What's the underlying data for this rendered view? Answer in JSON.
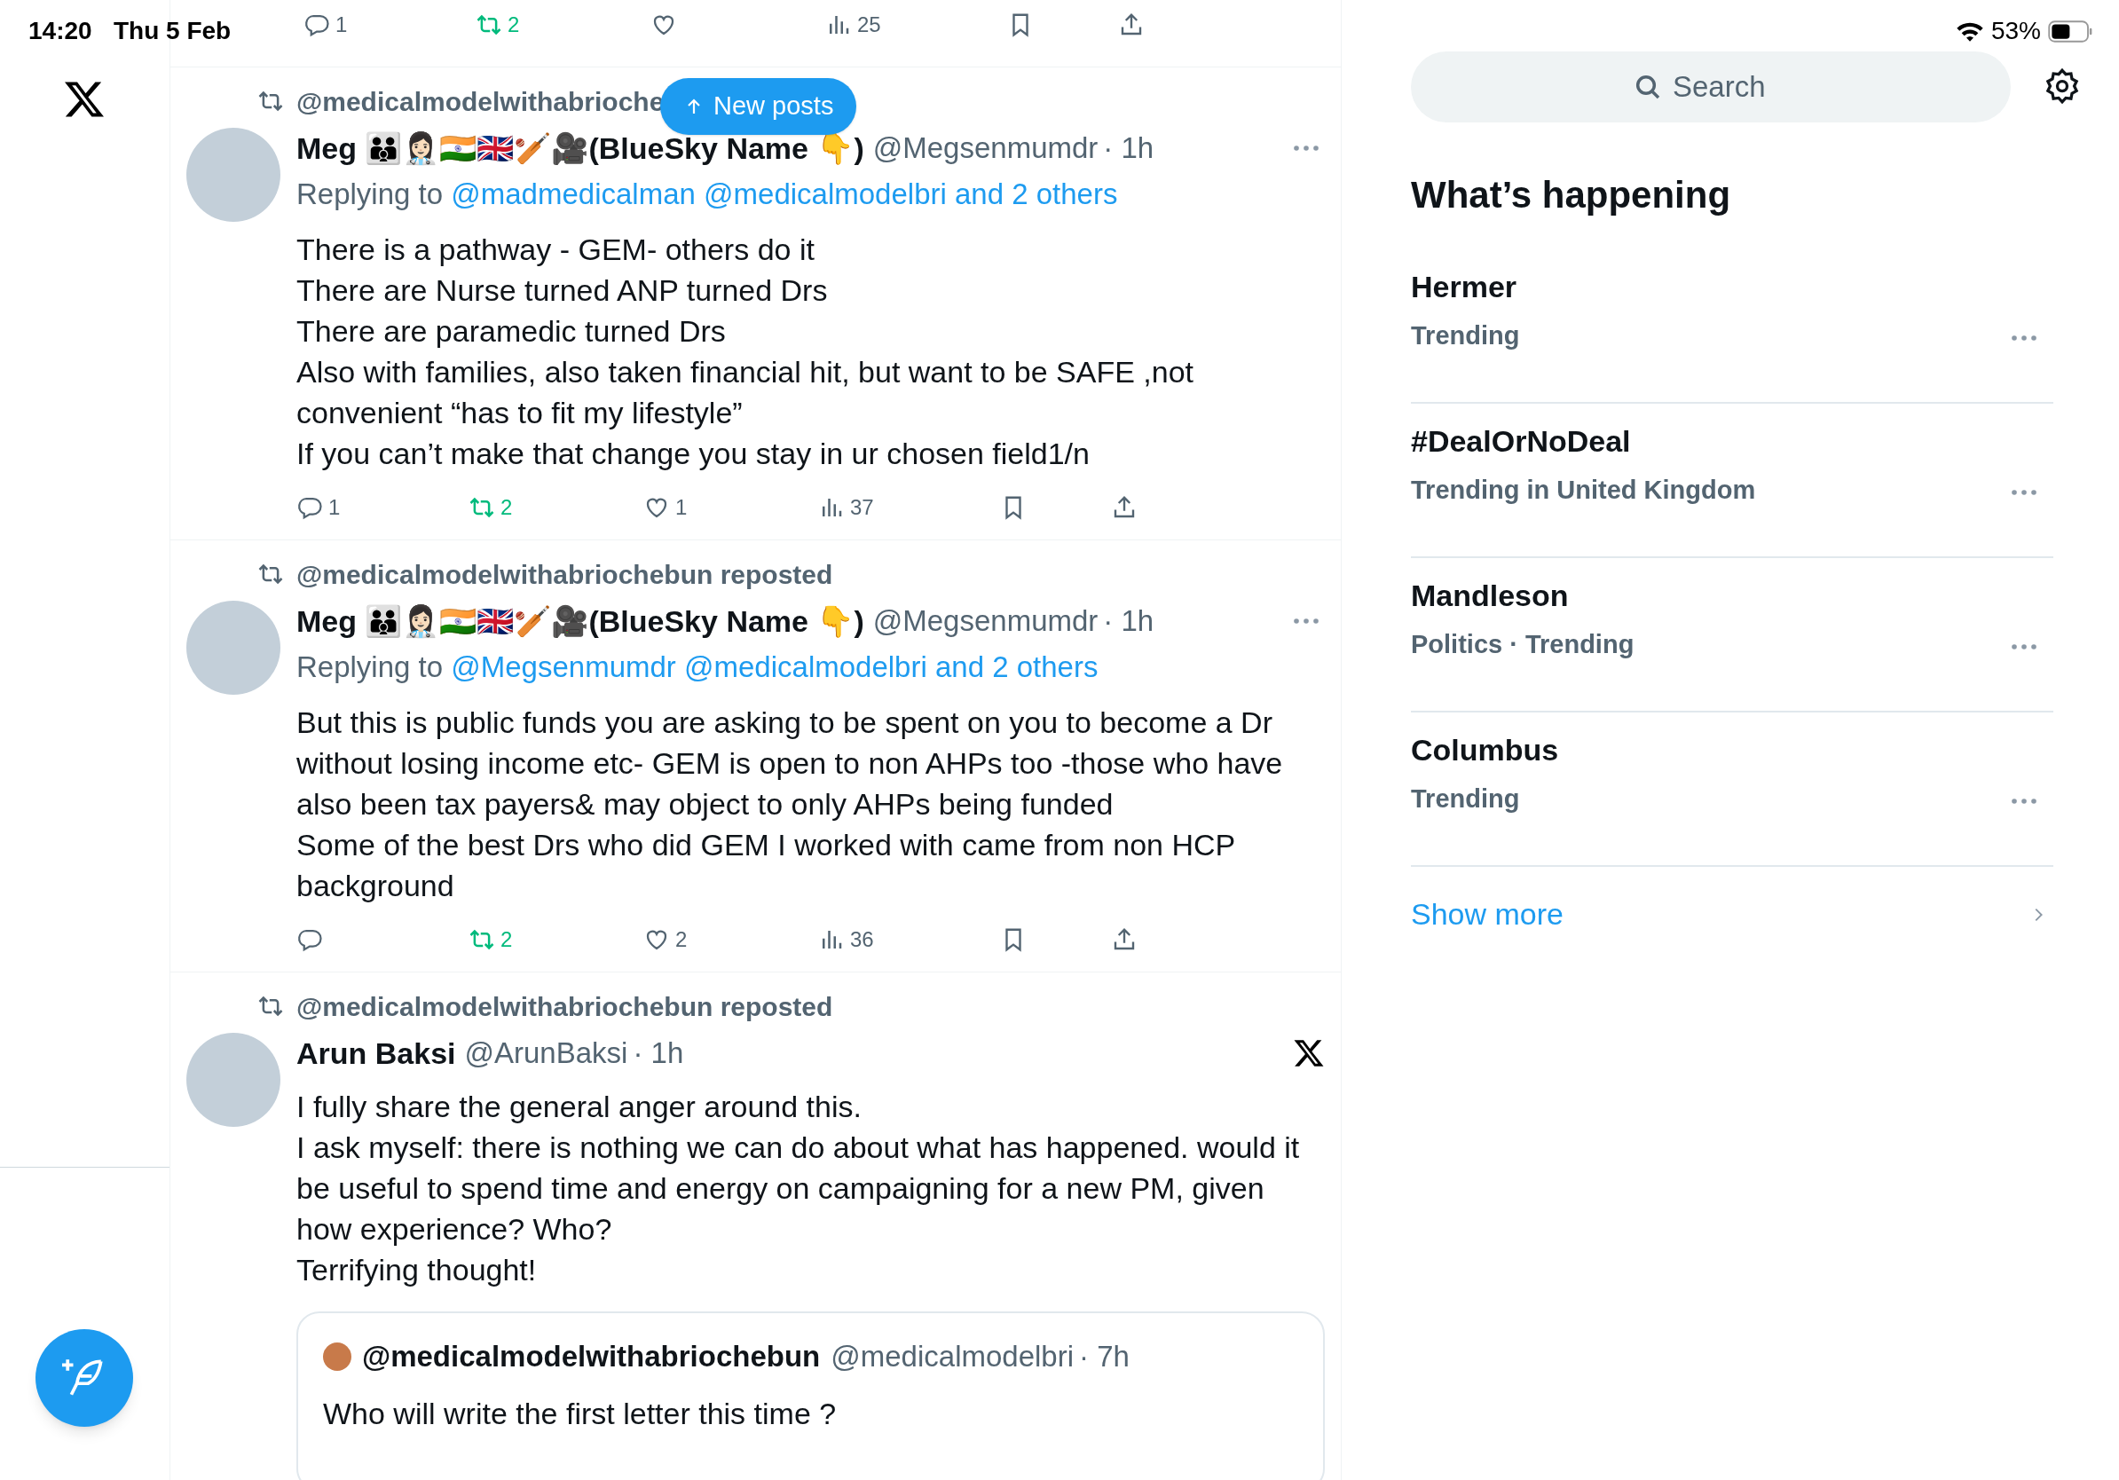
{
  "status_bar": {
    "time": "14:20",
    "date": "Thu 5 Feb",
    "battery": "53%"
  },
  "feed_top_actions": [
    {
      "kind": "reply",
      "count": "1",
      "active": false
    },
    {
      "kind": "repost",
      "count": "2",
      "active": true
    },
    {
      "kind": "like",
      "active": false
    },
    {
      "kind": "views",
      "count": "25",
      "active": false
    },
    {
      "kind": "bookmark",
      "active": false
    },
    {
      "kind": "share",
      "active": false
    }
  ],
  "new_posts_button": "New posts",
  "tweets": [
    {
      "reposted_by": "@medicalmodelwithabrioche",
      "name": "Meg 👪👩🏻‍⚕️🇮🇳🇬🇧🏏🎥(BlueSky Name 👇)",
      "handle": "@Megsenmumdr",
      "time": "· 1h",
      "more_menu": true,
      "x_badge": false,
      "replying": {
        "prefix": "Replying to",
        "mentions": [
          "@madmedicalman",
          "@medicalmodelbri",
          "and 2 others"
        ]
      },
      "body": "There is a pathway - GEM- others do it\nThere are Nurse turned ANP turned Drs\nThere are paramedic turned Drs\nAlso with families, also taken financial hit, but want to be SAFE ,not convenient “has to fit my lifestyle”\nIf you can’t make that change you stay in ur chosen field1/n",
      "actions": [
        {
          "kind": "reply",
          "count": "1",
          "active": false
        },
        {
          "kind": "repost",
          "count": "2",
          "active": true
        },
        {
          "kind": "like",
          "count": "1",
          "active": false
        },
        {
          "kind": "views",
          "count": "37",
          "active": false
        },
        {
          "kind": "bookmark",
          "active": false
        },
        {
          "kind": "share",
          "active": false
        }
      ]
    },
    {
      "reposted_by": "@medicalmodelwithabriochebun reposted",
      "name": "Meg 👪👩🏻‍⚕️🇮🇳🇬🇧🏏🎥(BlueSky Name 👇)",
      "handle": "@Megsenmumdr",
      "time": "· 1h",
      "more_menu": true,
      "x_badge": false,
      "replying": {
        "prefix": "Replying to",
        "mentions": [
          "@Megsenmumdr",
          "@medicalmodelbri",
          "and 2 others"
        ]
      },
      "body": "But this is public funds you are asking to be spent on you to become a Dr without losing income etc- GEM is open to non AHPs too -those who have also been tax payers& may object to only AHPs being funded\nSome of the best Drs who did GEM I worked with came from non HCP background",
      "actions": [
        {
          "kind": "reply",
          "active": false
        },
        {
          "kind": "repost",
          "count": "2",
          "active": true
        },
        {
          "kind": "like",
          "count": "2",
          "active": false
        },
        {
          "kind": "views",
          "count": "36",
          "active": false
        },
        {
          "kind": "bookmark",
          "active": false
        },
        {
          "kind": "share",
          "active": false
        }
      ]
    },
    {
      "reposted_by": "@medicalmodelwithabriochebun reposted",
      "name": "Arun Baksi",
      "handle": "@ArunBaksi",
      "time": "· 1h",
      "more_menu": false,
      "x_badge": true,
      "body": "I fully share the general anger around this.\nI ask myself: there is nothing we can do about what has happened. would it be useful to spend time and energy on campaigning for a new PM, given how experience? Who?\nTerrifying thought!",
      "quote": {
        "name": "@medicalmodelwithabriochebun",
        "handle": "@medicalmodelbri",
        "time": "· 7h",
        "text": "Who will write the first letter this time ?"
      }
    }
  ],
  "sidebar": {
    "search": {
      "placeholder": "Search"
    },
    "heading": "What’s happening",
    "trends": [
      {
        "name": "Hermer",
        "context": "Trending"
      },
      {
        "name": "#DealOrNoDeal",
        "context": "Trending in United Kingdom"
      },
      {
        "name": "Mandleson",
        "context": "Politics · Trending"
      },
      {
        "name": "Columbus",
        "context": "Trending"
      }
    ],
    "show_more": "Show more"
  }
}
